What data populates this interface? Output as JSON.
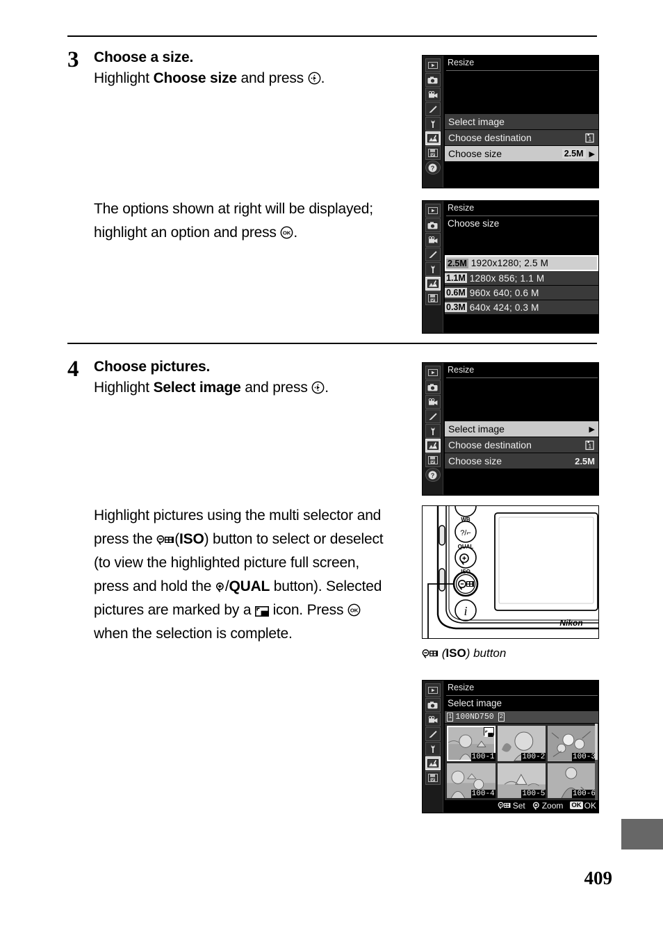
{
  "page": {
    "number": "409"
  },
  "steps": [
    {
      "num": "3",
      "title": "Choose a size.",
      "sub_before": "Highlight ",
      "sub_bold": "Choose size",
      "sub_after": " and press ",
      "sub_end": ".",
      "para_a": "The options shown at right will be displayed; highlight an option and press ",
      "para_a_end": "."
    },
    {
      "num": "4",
      "title": "Choose pictures.",
      "sub_before": "Highlight ",
      "sub_bold": "Select image",
      "sub_after": " and press ",
      "sub_end": ".",
      "para_1": "Highlight pictures using the multi selector and press the ",
      "para_2": "(",
      "para_iso": "ISO",
      "para_3": ") button to select or deselect (to view the highlighted picture full screen, press and hold the ",
      "para_qual": "QUAL",
      "para_4": " button). Selected pictures are marked by a ",
      "para_5": " icon.  Press ",
      "para_6": " when the selection is complete."
    }
  ],
  "screens": {
    "resize_menu_size": {
      "title": "Resize",
      "rows": [
        {
          "label": "Select image",
          "value": "",
          "highlight": false,
          "arrow": ""
        },
        {
          "label": "Choose destination",
          "value": "1",
          "highlight": false,
          "arrow": ""
        },
        {
          "label": "Choose size",
          "value": "2.5M",
          "highlight": true,
          "arrow": "▶"
        }
      ]
    },
    "choose_size": {
      "title": "Resize",
      "subtitle": "Choose size",
      "options": [
        {
          "badge": "2.5M",
          "dims": "1920x1280; 2.5 M",
          "selected": true
        },
        {
          "badge": "1.1M",
          "dims": "1280x  856; 1.1 M",
          "selected": false
        },
        {
          "badge": "0.6M",
          "dims": "  960x  640; 0.6 M",
          "selected": false
        },
        {
          "badge": "0.3M",
          "dims": "  640x  424; 0.3 M",
          "selected": false
        }
      ]
    },
    "resize_menu_select": {
      "title": "Resize",
      "rows": [
        {
          "label": "Select image",
          "value": "",
          "highlight": true,
          "arrow": "▶"
        },
        {
          "label": "Choose destination",
          "value": "1",
          "highlight": false,
          "arrow": ""
        },
        {
          "label": "Choose size",
          "value": "2.5M",
          "highlight": false,
          "arrow": ""
        }
      ]
    },
    "select_image": {
      "title": "Resize",
      "subtitle": "Select image",
      "folder": "100ND750",
      "slot_left": "1",
      "slot_right": "2",
      "thumbnails": [
        {
          "label": "100-1",
          "selected": true,
          "marked": true
        },
        {
          "label": "100-2",
          "selected": false,
          "marked": false
        },
        {
          "label": "100-3",
          "selected": false,
          "marked": false
        },
        {
          "label": "100-4",
          "selected": false,
          "marked": false
        },
        {
          "label": "100-5",
          "selected": false,
          "marked": false
        },
        {
          "label": "100-6",
          "selected": false,
          "marked": false
        }
      ],
      "footer": [
        {
          "icon": "zoom-out-thumbnail-icon",
          "label": "Set"
        },
        {
          "icon": "zoom-in-icon",
          "label": "Zoom"
        },
        {
          "icon": "ok-icon",
          "label": "OK"
        }
      ]
    }
  },
  "camera_figure": {
    "brand": "Nikon",
    "button_labels": {
      "wb": "WB",
      "qual": "QUAL",
      "iso": "ISO",
      "info": "i"
    },
    "caption_before": " (",
    "caption_bold": "ISO",
    "caption_after": ") button"
  },
  "colors": {
    "lcd_background": "#000000",
    "lcd_row": "#3b3b3b",
    "lcd_row_highlight": "#cacaca",
    "edge_tab": "#676767"
  }
}
